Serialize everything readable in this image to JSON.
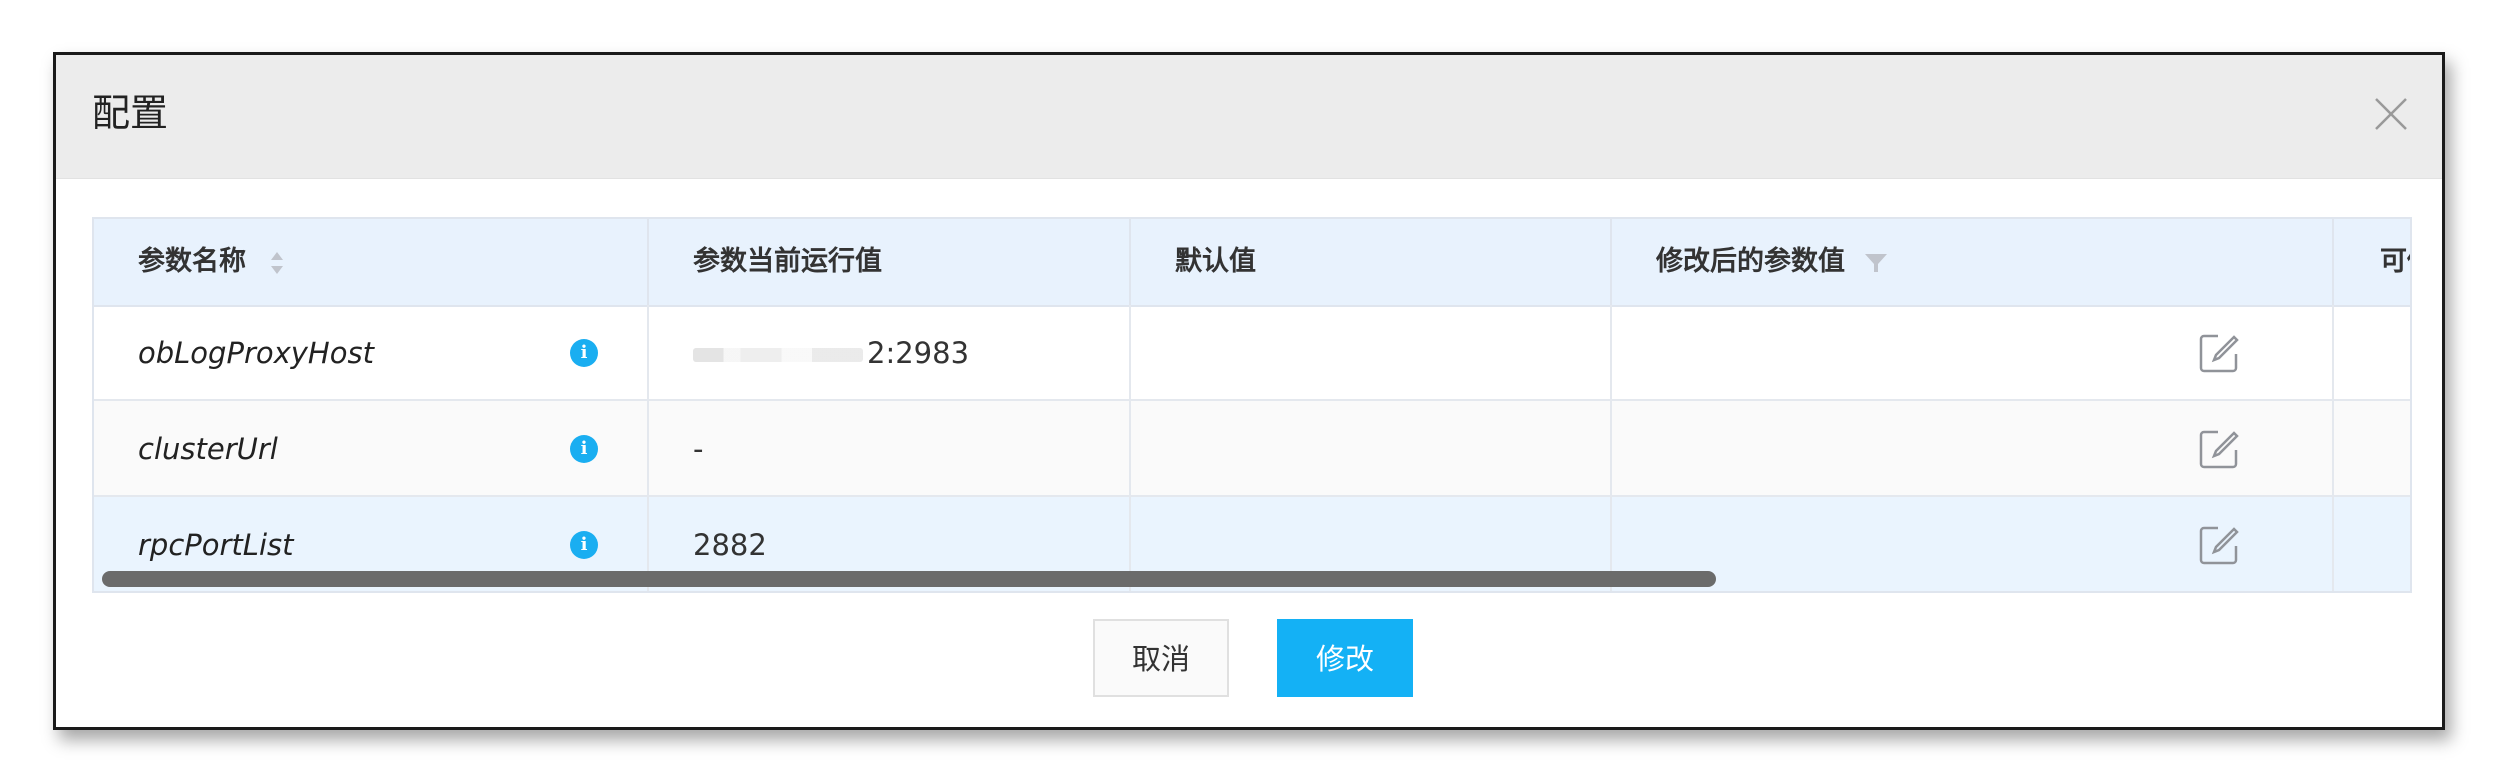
{
  "dialog": {
    "title": "配置",
    "close_icon": "close-icon"
  },
  "table": {
    "columns": [
      {
        "label": "参数名称",
        "sortable": true
      },
      {
        "label": "参数当前运行值"
      },
      {
        "label": "默认值"
      },
      {
        "label": "修改后的参数值",
        "filterable": true
      },
      {
        "label": "可修"
      }
    ],
    "rows": [
      {
        "name": "obLogProxyHost",
        "current": "2:2983",
        "current_masked": true,
        "default": "",
        "modified": ""
      },
      {
        "name": "clusterUrl",
        "current": "-",
        "default": "",
        "modified": ""
      },
      {
        "name": "rpcPortList",
        "current": "2882",
        "default": "",
        "modified": ""
      }
    ]
  },
  "footer": {
    "cancel_label": "取消",
    "confirm_label": "修改"
  },
  "colors": {
    "accent": "#14b1f5",
    "info": "#1aaef1",
    "header_bg": "#e8f2fd"
  }
}
